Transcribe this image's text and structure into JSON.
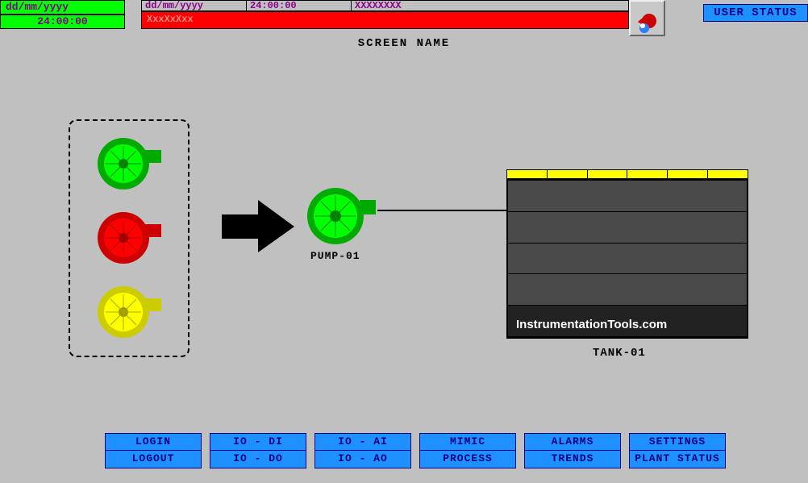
{
  "clock": {
    "date": "dd/mm/yyyy",
    "time": "24:00:00"
  },
  "alarm_header": {
    "date": "dd/mm/yyyy",
    "time": "24:00:00",
    "code": "XXXXXXXX"
  },
  "alarm_message": "XxxXxXxx",
  "user_status_btn": "USER STATUS",
  "screen_name": "SCREEN NAME",
  "pump": {
    "label": "PUMP-01"
  },
  "tank": {
    "label": "TANK-01",
    "watermark": "InstrumentationTools.com"
  },
  "nav": {
    "col1": [
      "LOGIN",
      "LOGOUT"
    ],
    "col2": [
      "IO - DI",
      "IO - DO"
    ],
    "col3": [
      "IO - AI",
      "IO - AO"
    ],
    "col4": [
      "MIMIC",
      "PROCESS"
    ],
    "col5": [
      "ALARMS",
      "TRENDS"
    ],
    "col6": [
      "SETTINGS",
      "PLANT STATUS"
    ]
  },
  "legend_colors": {
    "running": "#00c800",
    "stopped": "#ff0000",
    "fault": "#e6e600"
  }
}
